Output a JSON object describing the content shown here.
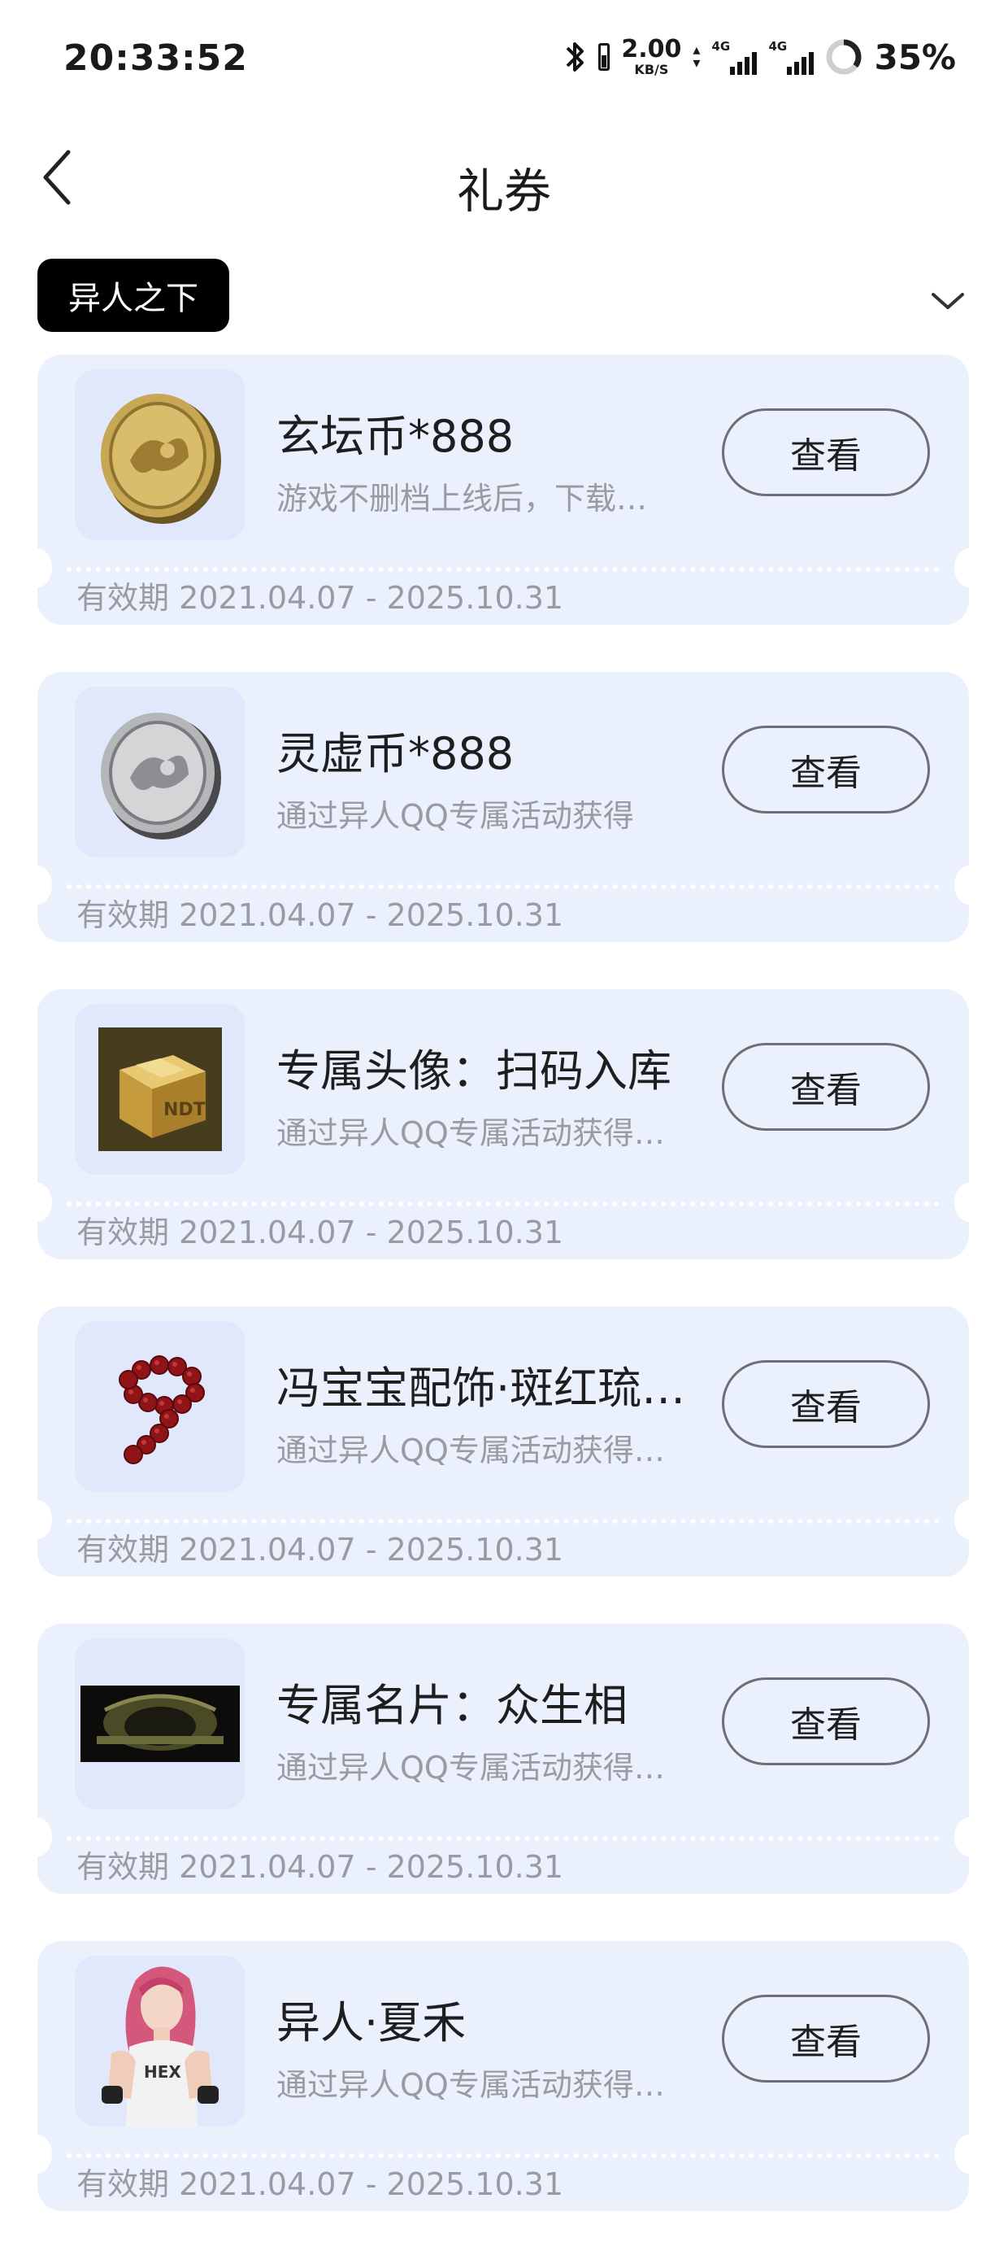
{
  "status_bar": {
    "time": "20:33:52",
    "net_speed_value": "2.00",
    "net_speed_unit": "KB/S",
    "signal1_label": "4G",
    "signal2_label": "4G",
    "battery_percent": "35%"
  },
  "header": {
    "title": "礼券",
    "back_icon": "chevron-left-icon"
  },
  "filter": {
    "game_tag": "异人之下",
    "dropdown_icon": "chevron-down-icon"
  },
  "coupons": [
    {
      "title": "玄坛币*888",
      "desc": "游戏不删档上线后，下载…",
      "button": "查看",
      "validity": "有效期 2021.04.07 - 2025.10.31",
      "image": "gold-coin"
    },
    {
      "title": "灵虚币*888",
      "desc": "通过异人QQ专属活动获得",
      "button": "查看",
      "validity": "有效期 2021.04.07 - 2025.10.31",
      "image": "silver-coin"
    },
    {
      "title": "专属头像：扫码入库",
      "desc": "通过异人QQ专属活动获得…",
      "button": "查看",
      "validity": "有效期 2021.04.07 - 2025.10.31",
      "image": "package-box"
    },
    {
      "title": "冯宝宝配饰·斑红琉…",
      "desc": "通过异人QQ专属活动获得…",
      "button": "查看",
      "validity": "有效期 2021.04.07 - 2025.10.31",
      "image": "red-bead-bracelet"
    },
    {
      "title": "专属名片：众生相",
      "desc": "通过异人QQ专属活动获得…",
      "button": "查看",
      "validity": "有效期 2021.04.07 - 2025.10.31",
      "image": "dark-tunnel-card"
    },
    {
      "title": "异人·夏禾",
      "desc": "通过异人QQ专属活动获得…",
      "button": "查看",
      "validity": "有效期 2021.04.07 - 2025.10.31",
      "image": "character-xiahe"
    }
  ]
}
